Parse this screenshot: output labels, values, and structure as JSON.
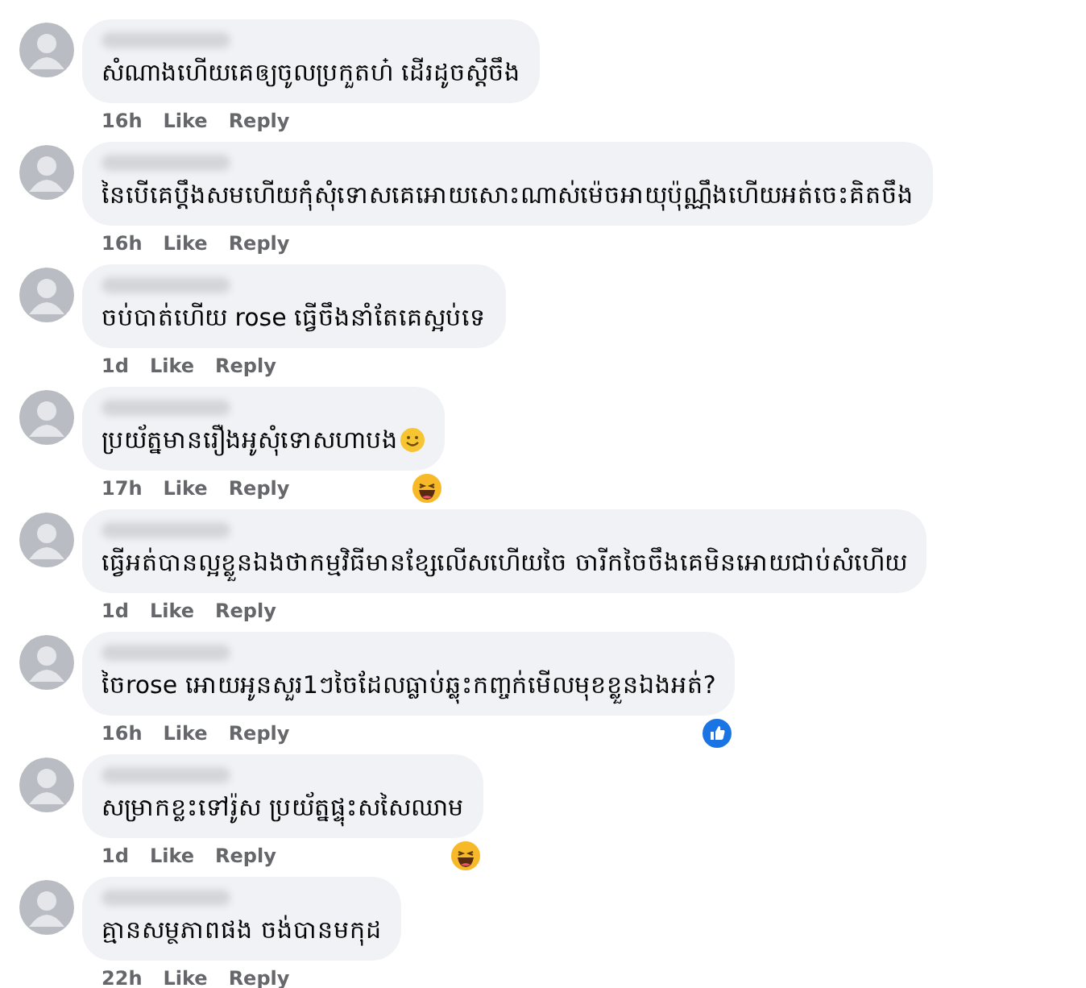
{
  "comments": [
    {
      "text": "សំណាងហើយគេឲ្យចូលប្រកួតហ៎ ដើរដូចស្ដីចឹង",
      "time": "16h",
      "like": "Like",
      "reply": "Reply"
    },
    {
      "text": "នៃបើគេប្ដឹងសមហើយកុំសុំទោសគេអោយសោះណាស់ម៉េចអាយុប៉ុណ្ណឹងហើយអត់ចេះគិតចឹង",
      "time": "16h",
      "like": "Like",
      "reply": "Reply"
    },
    {
      "text": "ចប់បាត់ហើយ rose ធ្វើចឹងនាំតែគេស្អប់ទេ",
      "time": "1d",
      "like": "Like",
      "reply": "Reply"
    },
    {
      "text": "ប្រយ័ត្នមានរឿងអូសុំទោសហាបង",
      "emoji": {
        "kind": "smile"
      },
      "time": "17h",
      "like": "Like",
      "reply": "Reply",
      "reaction": {
        "kind": "haha"
      }
    },
    {
      "text": "ធ្វើអត់បានល្អខ្លួនឯងថាកម្មវិធីមានខ្សែលើសហើយចៃ ចារីកចៃចឹងគេមិនអោយជាប់សំហើយ",
      "time": "1d",
      "like": "Like",
      "reply": "Reply"
    },
    {
      "text": "ចៃrose អោយអូនសួរ1ៗចៃដែលធ្លាប់ឆ្លុះកញ្ចក់មើលមុខខ្លួនឯងអត់?",
      "time": "16h",
      "like": "Like",
      "reply": "Reply",
      "reaction": {
        "kind": "like"
      }
    },
    {
      "text": "សម្រាកខ្លះទៅរ៉ូស ប្រយ័ត្នផ្ទុះសសៃឈាម",
      "time": "1d",
      "like": "Like",
      "reply": "Reply",
      "reaction": {
        "kind": "haha"
      }
    },
    {
      "text": "គ្មានសម្ថភាពផង ចង់បានមកុដ",
      "time": "22h",
      "like": "Like",
      "reply": "Reply"
    }
  ]
}
